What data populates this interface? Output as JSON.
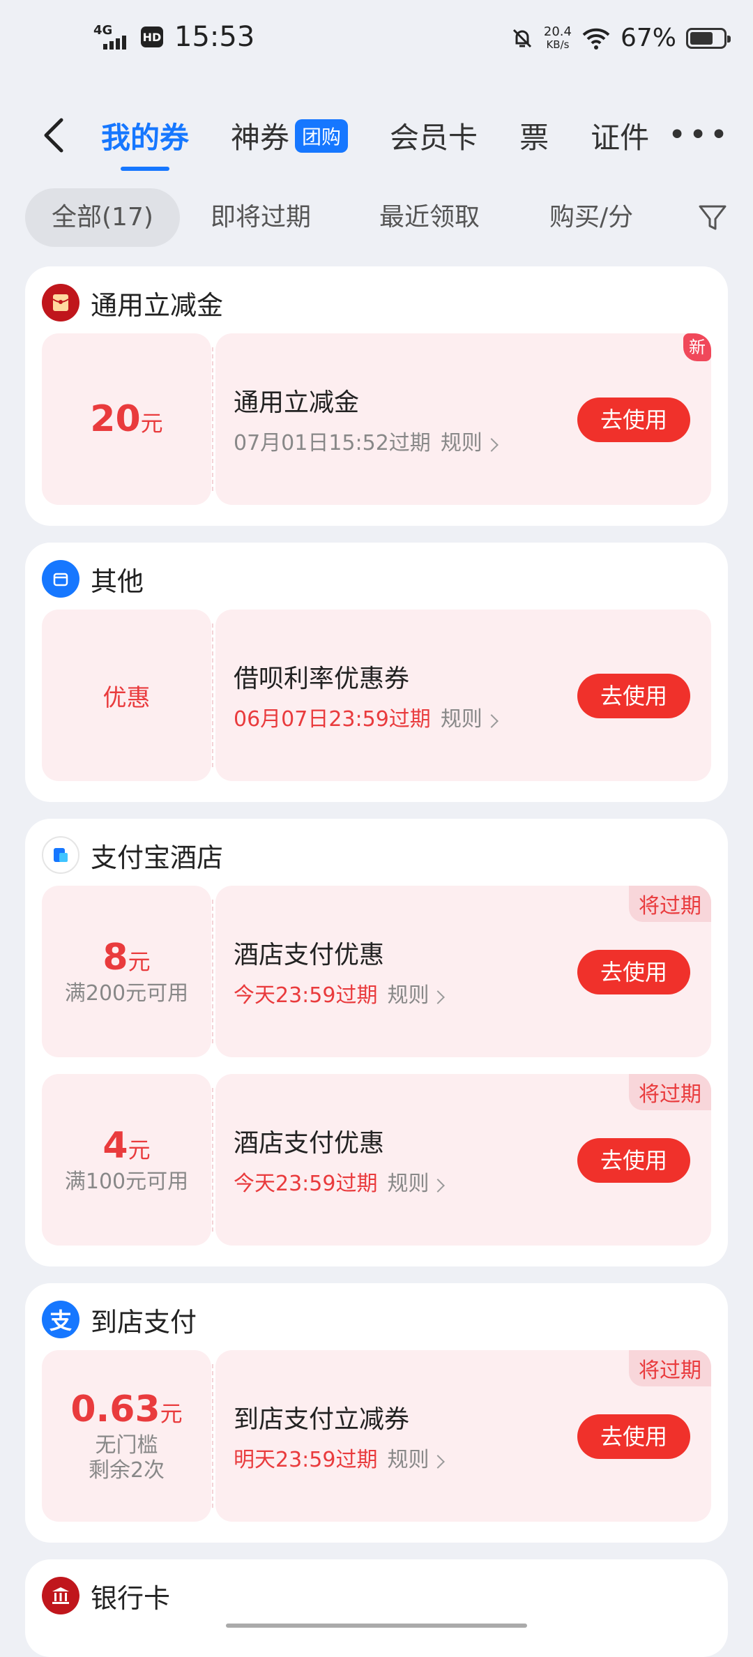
{
  "status_bar": {
    "network": "4G",
    "hd": "HD",
    "time": "15:53",
    "speed_value": "20.4",
    "speed_unit": "KB/s",
    "battery": "67%"
  },
  "nav": {
    "tabs": [
      "我的券",
      "神券",
      "会员卡",
      "票",
      "证件"
    ],
    "tuangou_badge": "团购"
  },
  "filters": [
    "全部(17)",
    "即将过期",
    "最近领取",
    "购买/分"
  ],
  "sections": [
    {
      "title": "通用立减金",
      "coupons": [
        {
          "amount": "20",
          "unit": "元",
          "name": "通用立减金",
          "expiry": "07月01日15:52过期",
          "rule": "规则",
          "button": "去使用",
          "tag": "新"
        }
      ]
    },
    {
      "title": "其他",
      "coupons": [
        {
          "perk": "优惠",
          "name": "借呗利率优惠券",
          "expiry": "06月07日23:59过期",
          "rule": "规则",
          "button": "去使用"
        }
      ]
    },
    {
      "title": "支付宝酒店",
      "coupons": [
        {
          "amount": "8",
          "unit": "元",
          "condition": "满200元可用",
          "name": "酒店支付优惠",
          "expiry": "今天23:59过期",
          "rule": "规则",
          "button": "去使用",
          "tag": "将过期"
        },
        {
          "amount": "4",
          "unit": "元",
          "condition": "满100元可用",
          "name": "酒店支付优惠",
          "expiry": "今天23:59过期",
          "rule": "规则",
          "button": "去使用",
          "tag": "将过期"
        }
      ]
    },
    {
      "title": "到店支付",
      "coupons": [
        {
          "amount": "0.63",
          "unit": "元",
          "condition": "无门槛",
          "condition2": "剩余2次",
          "name": "到店支付立减券",
          "expiry": "明天23:59过期",
          "rule": "规则",
          "button": "去使用",
          "tag": "将过期"
        }
      ]
    },
    {
      "title": "银行卡"
    }
  ],
  "colors": {
    "accent": "#1677ff",
    "red": "#e93b3d",
    "button": "#f0312b",
    "coupon_bg": "#fdeef0"
  }
}
